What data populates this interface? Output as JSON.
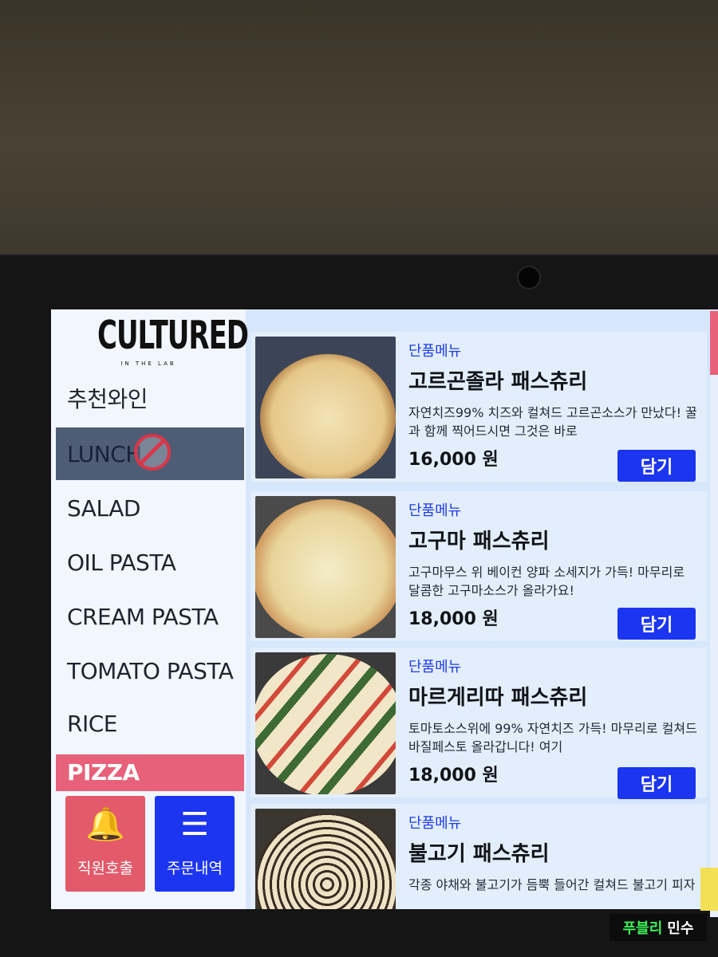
{
  "brand": {
    "logo_main": "CULTURED",
    "logo_sub": "IN THE LAB"
  },
  "sidebar": {
    "categories": [
      {
        "label": "추천와인"
      },
      {
        "label": "LUNCH",
        "state": "unavailable"
      },
      {
        "label": "SALAD"
      },
      {
        "label": "OIL PASTA"
      },
      {
        "label": "CREAM PASTA"
      },
      {
        "label": "TOMATO PASTA"
      },
      {
        "label": "RICE"
      },
      {
        "label": "PIZZA",
        "state": "selected"
      }
    ],
    "staff_call_label": "직원호출",
    "order_history_label": "주문내역"
  },
  "menu": {
    "items": [
      {
        "tag": "단품메뉴",
        "name": "고르곤졸라 패스츄리",
        "desc": "자연치즈99% 치즈와 컬쳐드 고르곤소스가 만났다! 꿀과 함께 찍어드시면 그것은 바로",
        "price": "16,000 원",
        "add_label": "담기"
      },
      {
        "tag": "단품메뉴",
        "name": "고구마 패스츄리",
        "desc": "고구마무스 위 베이컨 양파 소세지가 가득! 마무리로 달콤한 고구마소스가 올라가요!",
        "price": "18,000 원",
        "add_label": "담기"
      },
      {
        "tag": "단품메뉴",
        "name": "마르게리따 패스츄리",
        "desc": "토마토소스위에 99% 자연치즈 가득! 마무리로 컬쳐드 바질페스토 올라갑니다! 여기",
        "price": "18,000 원",
        "add_label": "담기"
      },
      {
        "tag": "단품메뉴",
        "name": "불고기 패스츄리",
        "desc": "각종 야채와 불고기가 듬뿍 들어간 컬쳐드 불고기 피자",
        "price": "",
        "add_label": ""
      }
    ]
  },
  "watermark": {
    "green_text": "푸블리",
    "white_text": "민수"
  },
  "colors": {
    "accent_blue": "#1c35f0",
    "selected_pink": "#e8617a",
    "tag_blue": "#1f3ce8"
  }
}
